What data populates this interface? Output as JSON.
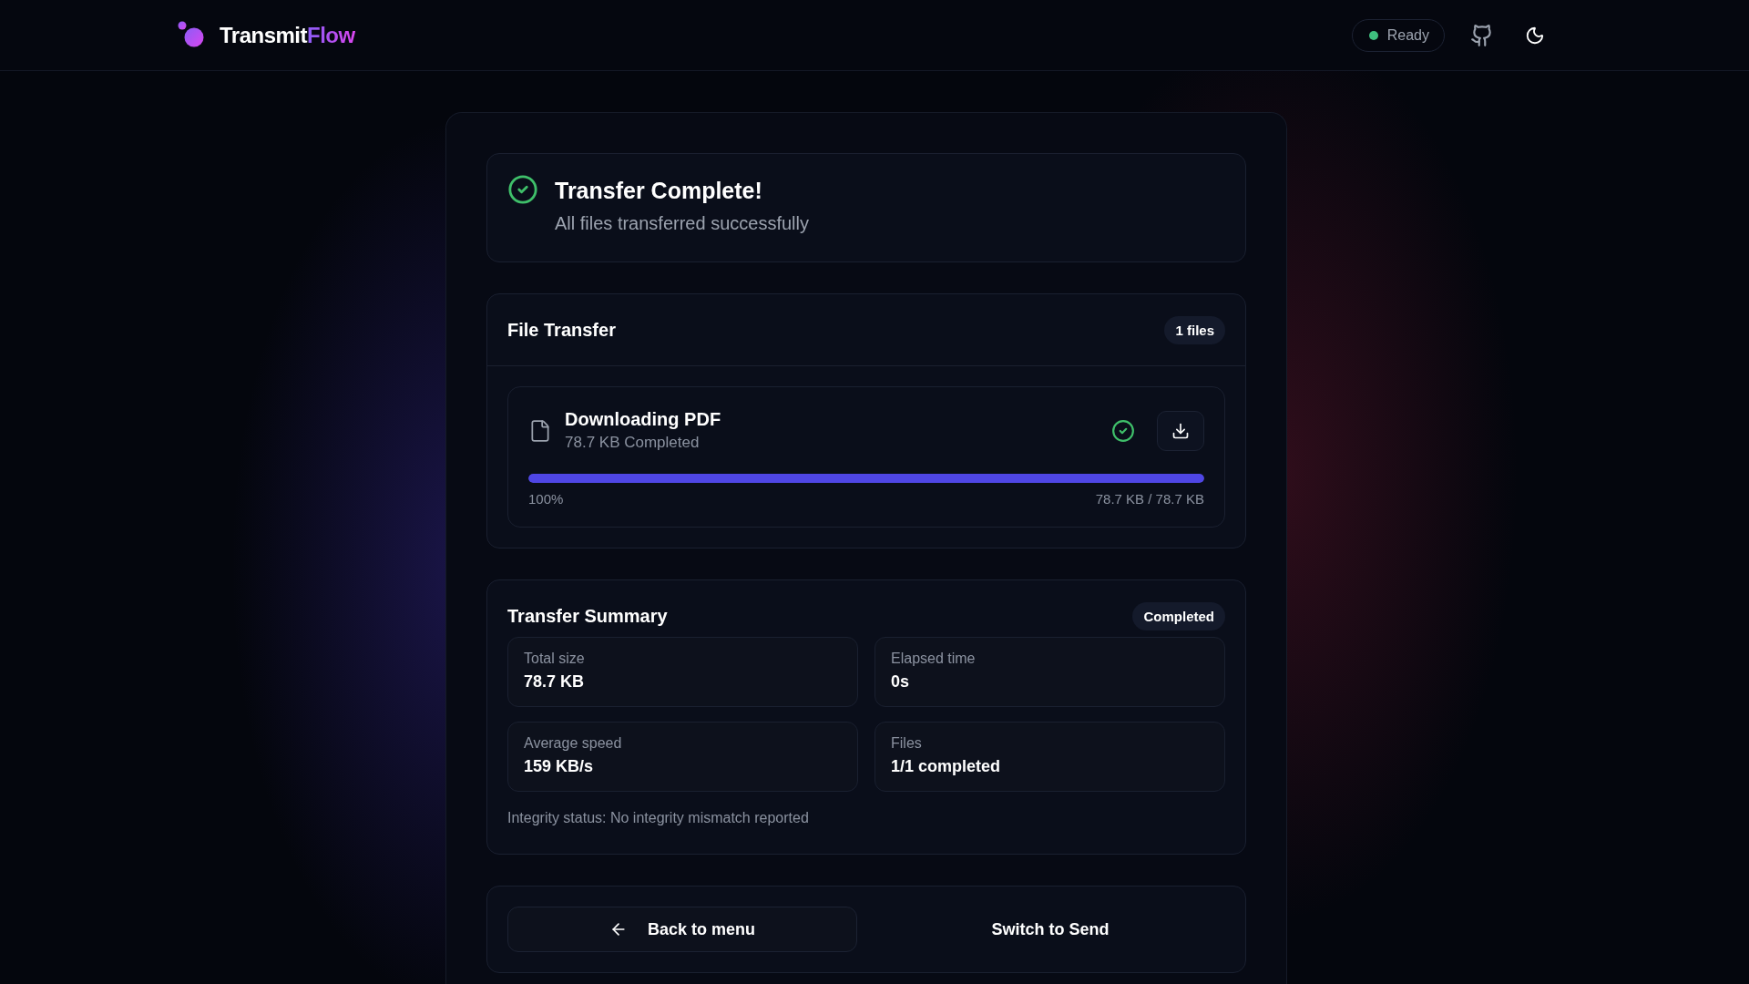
{
  "header": {
    "brand": {
      "name": "Transmit",
      "accent": "Flow"
    },
    "status": {
      "label": "Ready",
      "color": "#3fbf7f"
    }
  },
  "completion": {
    "title": "Transfer Complete!",
    "subtitle": "All files transferred successfully"
  },
  "file_transfer": {
    "title": "File Transfer",
    "count": "1 files",
    "files": [
      {
        "name": "Downloading PDF",
        "status": "78.7 KB Completed",
        "done": true,
        "level": 1,
        "percent": "100%",
        "progress_text": "78.7 KB / 78.7 KB"
      }
    ]
  },
  "summary": {
    "title": "Transfer Summary",
    "badge": "Completed",
    "stats": [
      {
        "label": "Total size",
        "value": "78.7 KB"
      },
      {
        "label": "Elapsed time",
        "value": "0s"
      },
      {
        "label": "Average speed",
        "value": "159 KB/s"
      },
      {
        "label": "Files",
        "value": "1/1 completed"
      }
    ],
    "integrity": "Integrity status: No integrity mismatch reported"
  },
  "actions": [
    {
      "label": "Back to menu",
      "kind": "outlined"
    },
    {
      "label": "Switch to Send",
      "kind": "plain"
    }
  ]
}
